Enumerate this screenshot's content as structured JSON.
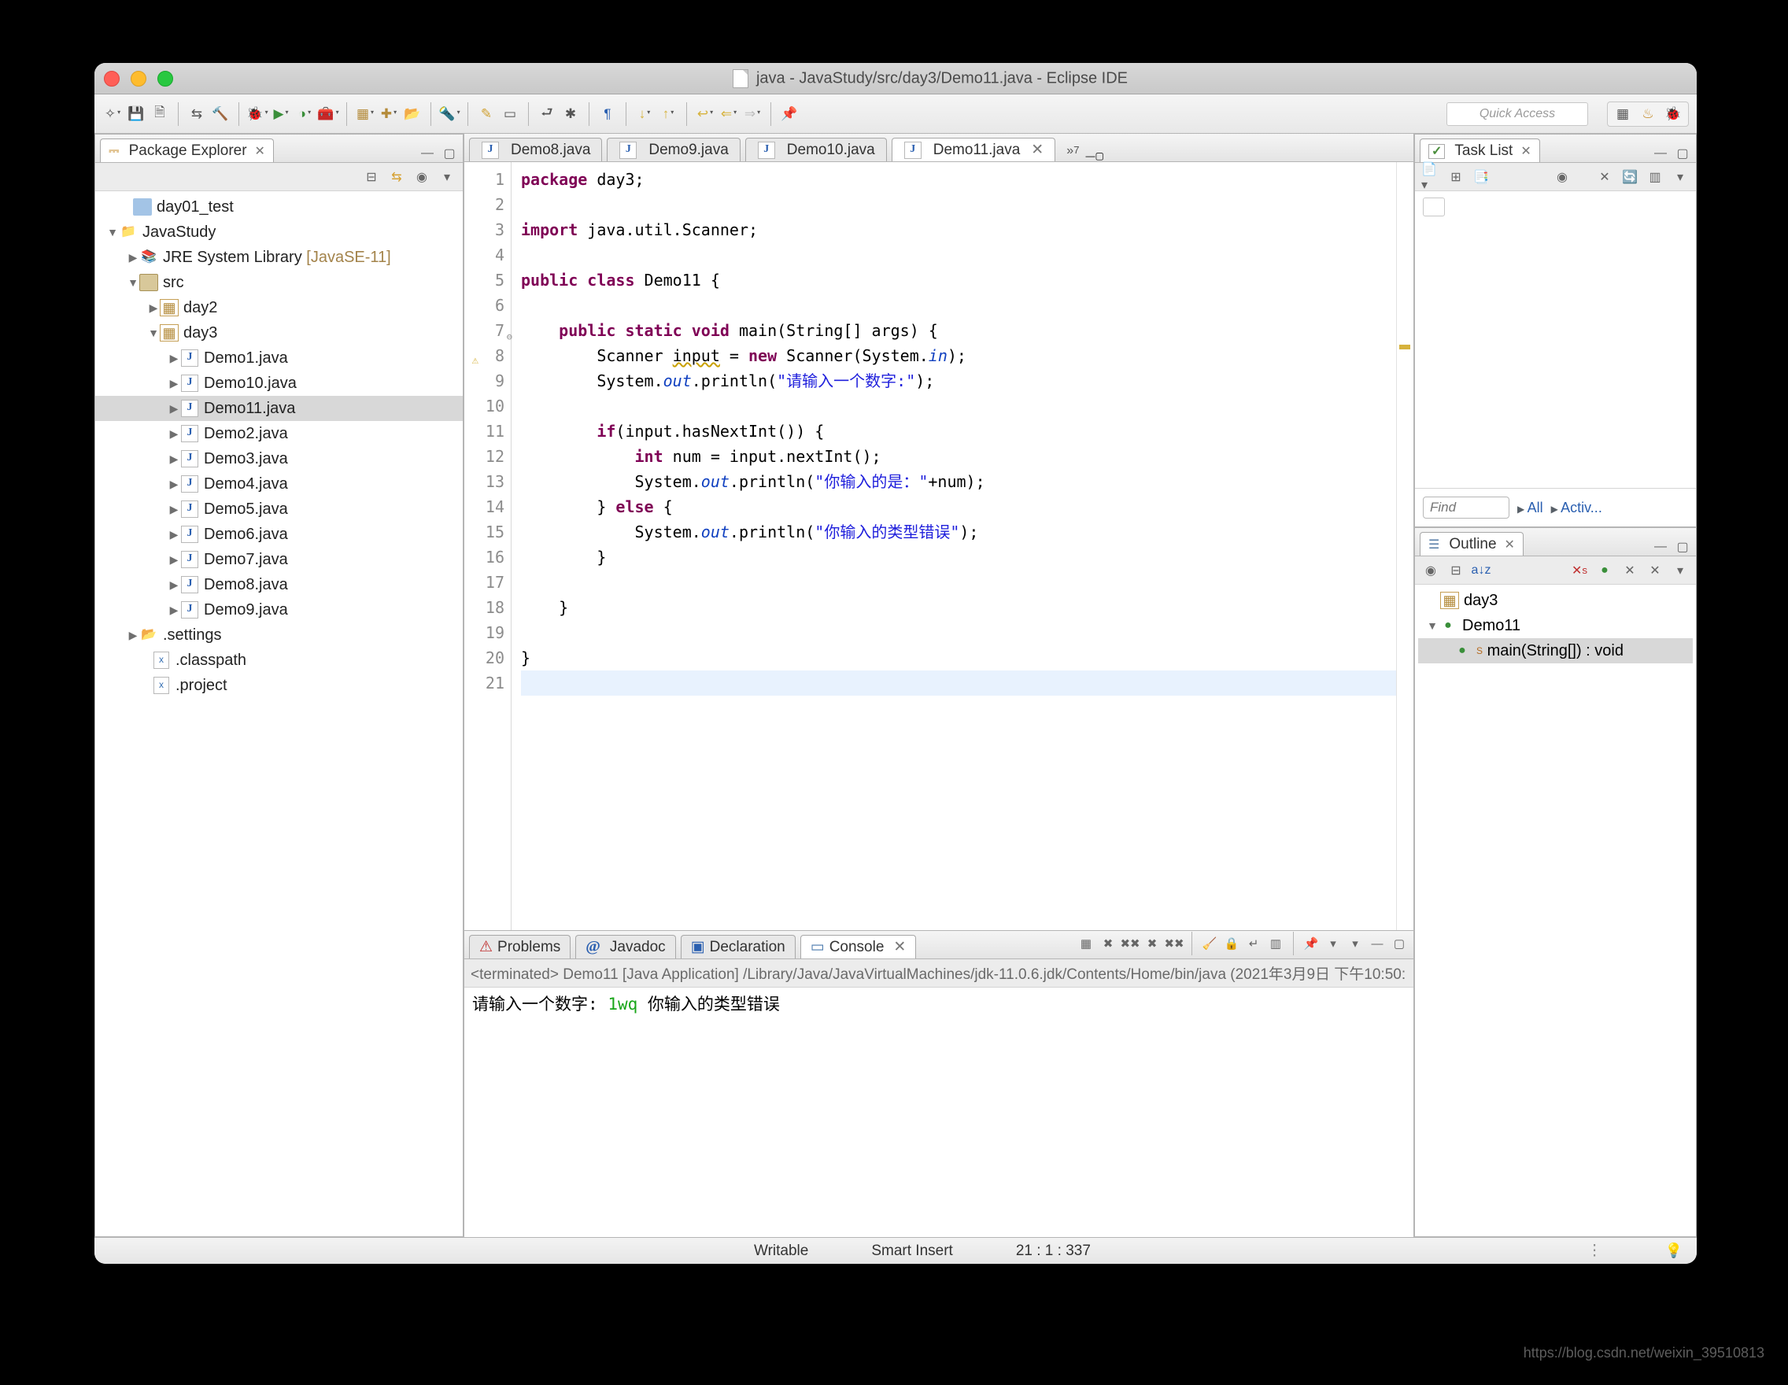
{
  "window": {
    "title": "java - JavaStudy/src/day3/Demo11.java - Eclipse IDE"
  },
  "quick_access_placeholder": "Quick Access",
  "package_explorer": {
    "title": "Package Explorer",
    "nodes": {
      "day01_test": "day01_test",
      "java_study": "JavaStudy",
      "jre": "JRE System Library",
      "jre_suffix": "[JavaSE-11]",
      "src": "src",
      "day2": "day2",
      "day3": "day3",
      "files": [
        "Demo1.java",
        "Demo10.java",
        "Demo11.java",
        "Demo2.java",
        "Demo3.java",
        "Demo4.java",
        "Demo5.java",
        "Demo6.java",
        "Demo7.java",
        "Demo8.java",
        "Demo9.java"
      ],
      "settings": ".settings",
      "classpath": ".classpath",
      "project": ".project"
    }
  },
  "editor": {
    "tabs": [
      "Demo8.java",
      "Demo9.java",
      "Demo10.java",
      "Demo11.java"
    ],
    "active_tab": "Demo11.java",
    "overflow": "»",
    "overflow_count": "7",
    "line_numbers": [
      1,
      2,
      3,
      4,
      5,
      6,
      7,
      8,
      9,
      10,
      11,
      12,
      13,
      14,
      15,
      16,
      17,
      18,
      19,
      20,
      21
    ],
    "code": {
      "l1": "package day3;",
      "l3": "import java.util.Scanner;",
      "l5a": "public class",
      "l5b": " Demo11 {",
      "l7a": "public static void",
      "l7b": " main(String[] args) {",
      "l8a": "Scanner ",
      "l8b": "input",
      "l8c": " = ",
      "l8d": "new",
      "l8e": " Scanner(System.",
      "l8f": "in",
      "l8g": ");",
      "l9a": "System.",
      "l9b": "out",
      "l9c": ".println(",
      "l9d": "\"请输入一个数字:\"",
      "l9e": ");",
      "l11a": "if",
      "l11b": "(input.hasNextInt()) {",
      "l12a": "int",
      "l12b": " num = input.nextInt();",
      "l13a": "System.",
      "l13b": "out",
      "l13c": ".println(",
      "l13d": "\"你输入的是：\"",
      "l13e": "+num);",
      "l14a": "} ",
      "l14b": "else",
      "l14c": " {",
      "l15a": "System.",
      "l15b": "out",
      "l15c": ".println(",
      "l15d": "\"你输入的类型错误\"",
      "l15e": ");",
      "l16": "}",
      "l18": "}",
      "l20": "}"
    }
  },
  "task_list": {
    "title": "Task List",
    "find_placeholder": "Find",
    "all_link": "All",
    "activ_link": "Activ..."
  },
  "outline": {
    "title": "Outline",
    "pkg": "day3",
    "class": "Demo11",
    "method": "main(String[]) : void",
    "static_marker": "S"
  },
  "bottom": {
    "tabs": {
      "problems": "Problems",
      "javadoc": "Javadoc",
      "declaration": "Declaration",
      "console": "Console"
    },
    "console_header": "<terminated> Demo11 [Java Application] /Library/Java/JavaVirtualMachines/jdk-11.0.6.jdk/Contents/Home/bin/java (2021年3月9日 下午10:50:",
    "line1": "请输入一个数字:",
    "input": "1wq",
    "line3": "你输入的类型错误"
  },
  "status": {
    "writable": "Writable",
    "insert": "Smart Insert",
    "pos": "21 : 1 : 337"
  },
  "watermark": "https://blog.csdn.net/weixin_39510813"
}
